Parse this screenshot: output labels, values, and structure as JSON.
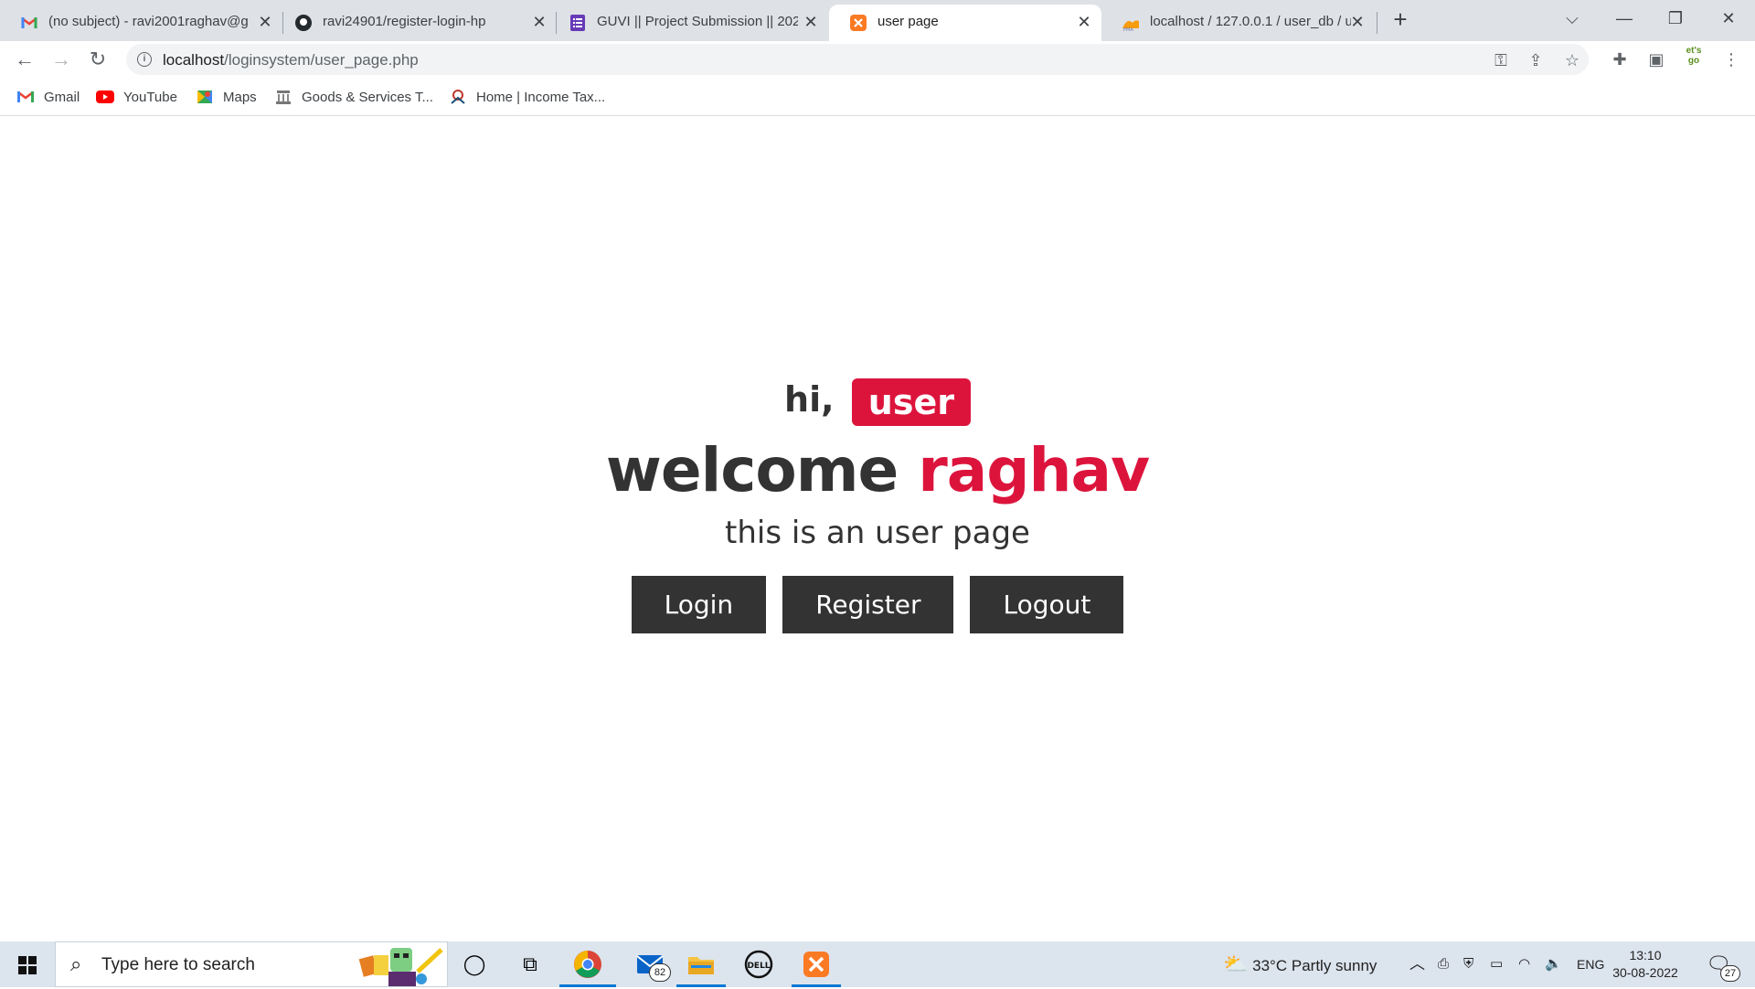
{
  "browser": {
    "tabs": [
      {
        "title": "(no subject) - ravi2001raghav@g",
        "icon": "gmail-icon"
      },
      {
        "title": "ravi24901/register-login-hp",
        "icon": "github-icon"
      },
      {
        "title": "GUVI || Project Submission || 202",
        "icon": "forms-icon"
      },
      {
        "title": "user page",
        "icon": "xampp-icon"
      },
      {
        "title": "localhost / 127.0.0.1 / user_db / u",
        "icon": "phpmyadmin-icon"
      }
    ],
    "address": {
      "host": "localhost",
      "path": "/loginsystem/user_page.php"
    },
    "profile_label": "et's go",
    "bookmarks": [
      {
        "label": "Gmail",
        "icon": "gmail-icon"
      },
      {
        "label": "YouTube",
        "icon": "youtube-icon"
      },
      {
        "label": "Maps",
        "icon": "maps-icon"
      },
      {
        "label": "Goods & Services T...",
        "icon": "gst-icon"
      },
      {
        "label": "Home | Income Tax...",
        "icon": "income-tax-icon"
      }
    ]
  },
  "page": {
    "greeting": "hi,",
    "role_badge": "user",
    "welcome_word": "welcome",
    "username": "raghav",
    "subtitle": "this is an user page",
    "buttons": {
      "login": "Login",
      "register": "Register",
      "logout": "Logout"
    },
    "accent_color": "#dc143c",
    "dark_color": "#333333"
  },
  "taskbar": {
    "search_placeholder": "Type here to search",
    "mail_badge": "82",
    "weather": {
      "temp": "33°C",
      "condition": "Partly sunny"
    },
    "language": "ENG",
    "time": "13:10",
    "date": "30-08-2022",
    "notification_count": "27"
  }
}
